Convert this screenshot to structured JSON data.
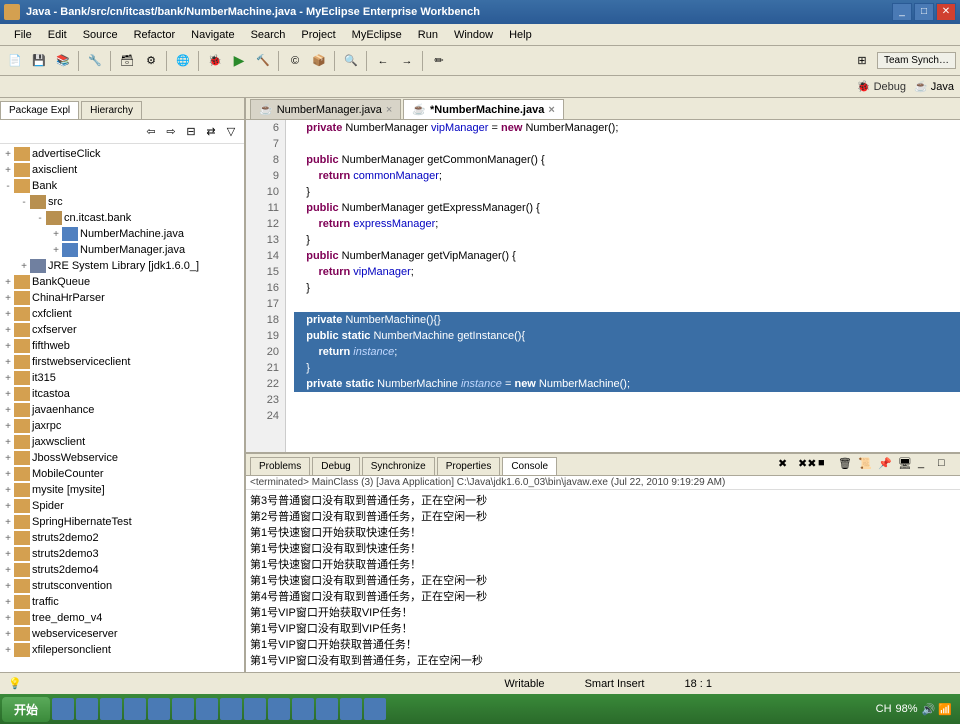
{
  "window": {
    "title": "Java - Bank/src/cn/itcast/bank/NumberMachine.java - MyEclipse Enterprise Workbench"
  },
  "menu": [
    "File",
    "Edit",
    "Source",
    "Refactor",
    "Navigate",
    "Search",
    "Project",
    "MyEclipse",
    "Run",
    "Window",
    "Help"
  ],
  "perspectives": {
    "teamSync": "Team Synch…",
    "debug": "Debug",
    "java": "Java"
  },
  "leftTabs": {
    "pkg": "Package Expl",
    "hier": "Hierarchy"
  },
  "tree": {
    "items": [
      {
        "l": 0,
        "t": "+",
        "i": "folder",
        "n": "advertiseClick"
      },
      {
        "l": 0,
        "t": "+",
        "i": "folder",
        "n": "axisclient"
      },
      {
        "l": 0,
        "t": "-",
        "i": "folder",
        "n": "Bank"
      },
      {
        "l": 1,
        "t": "-",
        "i": "pkg",
        "n": "src"
      },
      {
        "l": 2,
        "t": "-",
        "i": "pkg",
        "n": "cn.itcast.bank"
      },
      {
        "l": 3,
        "t": "+",
        "i": "jfile",
        "n": "NumberMachine.java"
      },
      {
        "l": 3,
        "t": "+",
        "i": "jfile",
        "n": "NumberManager.java"
      },
      {
        "l": 1,
        "t": "+",
        "i": "lib",
        "n": "JRE System Library [jdk1.6.0_]"
      },
      {
        "l": 0,
        "t": "+",
        "i": "folder",
        "n": "BankQueue"
      },
      {
        "l": 0,
        "t": "+",
        "i": "folder",
        "n": "ChinaHrParser"
      },
      {
        "l": 0,
        "t": "+",
        "i": "folder",
        "n": "cxfclient"
      },
      {
        "l": 0,
        "t": "+",
        "i": "folder",
        "n": "cxfserver"
      },
      {
        "l": 0,
        "t": "+",
        "i": "folder",
        "n": "fifthweb"
      },
      {
        "l": 0,
        "t": "+",
        "i": "folder",
        "n": "firstwebserviceclient"
      },
      {
        "l": 0,
        "t": "+",
        "i": "folder",
        "n": "it315"
      },
      {
        "l": 0,
        "t": "+",
        "i": "folder",
        "n": "itcastoa"
      },
      {
        "l": 0,
        "t": "+",
        "i": "folder",
        "n": "javaenhance"
      },
      {
        "l": 0,
        "t": "+",
        "i": "folder",
        "n": "jaxrpc"
      },
      {
        "l": 0,
        "t": "+",
        "i": "folder",
        "n": "jaxwsclient"
      },
      {
        "l": 0,
        "t": "+",
        "i": "folder",
        "n": "JbossWebservice"
      },
      {
        "l": 0,
        "t": "+",
        "i": "folder",
        "n": "MobileCounter"
      },
      {
        "l": 0,
        "t": "+",
        "i": "folder",
        "n": "mysite [mysite]"
      },
      {
        "l": 0,
        "t": "+",
        "i": "folder",
        "n": "Spider"
      },
      {
        "l": 0,
        "t": "+",
        "i": "folder",
        "n": "SpringHibernateTest"
      },
      {
        "l": 0,
        "t": "+",
        "i": "folder",
        "n": "struts2demo2"
      },
      {
        "l": 0,
        "t": "+",
        "i": "folder",
        "n": "struts2demo3"
      },
      {
        "l": 0,
        "t": "+",
        "i": "folder",
        "n": "struts2demo4"
      },
      {
        "l": 0,
        "t": "+",
        "i": "folder",
        "n": "strutsconvention"
      },
      {
        "l": 0,
        "t": "+",
        "i": "folder",
        "n": "traffic"
      },
      {
        "l": 0,
        "t": "+",
        "i": "folder",
        "n": "tree_demo_v4"
      },
      {
        "l": 0,
        "t": "+",
        "i": "folder",
        "n": "webserviceserver"
      },
      {
        "l": 0,
        "t": "+",
        "i": "folder",
        "n": "xfilepersonclient"
      }
    ]
  },
  "editorTabs": [
    {
      "name": "NumberManager.java",
      "active": false
    },
    {
      "name": "*NumberMachine.java",
      "active": true
    }
  ],
  "code": {
    "startLine": 6,
    "lines": [
      {
        "n": 6,
        "sel": false,
        "html": "    <span class='kw'>private</span> NumberManager <span class='fld'>vipManager</span> = <span class='kw'>new</span> NumberManager();"
      },
      {
        "n": 7,
        "sel": false,
        "html": ""
      },
      {
        "n": 8,
        "sel": false,
        "html": "    <span class='kw'>public</span> NumberManager getCommonManager() {"
      },
      {
        "n": 9,
        "sel": false,
        "html": "        <span class='kw'>return</span> <span class='fld'>commonManager</span>;"
      },
      {
        "n": 10,
        "sel": false,
        "html": "    }"
      },
      {
        "n": 11,
        "sel": false,
        "html": "    <span class='kw'>public</span> NumberManager getExpressManager() {"
      },
      {
        "n": 12,
        "sel": false,
        "html": "        <span class='kw'>return</span> <span class='fld'>expressManager</span>;"
      },
      {
        "n": 13,
        "sel": false,
        "html": "    }"
      },
      {
        "n": 14,
        "sel": false,
        "html": "    <span class='kw'>public</span> NumberManager getVipManager() {"
      },
      {
        "n": 15,
        "sel": false,
        "html": "        <span class='kw'>return</span> <span class='fld'>vipManager</span>;"
      },
      {
        "n": 16,
        "sel": false,
        "html": "    }"
      },
      {
        "n": 17,
        "sel": false,
        "html": ""
      },
      {
        "n": 18,
        "sel": true,
        "html": "    <span class='kw'>private</span> NumberMachine(){}"
      },
      {
        "n": 19,
        "sel": true,
        "html": "    <span class='kw'>public static</span> NumberMachine getInstance(){"
      },
      {
        "n": 20,
        "sel": true,
        "html": "        <span class='kw'>return</span> <span class='fld'>instance</span>;"
      },
      {
        "n": 21,
        "sel": true,
        "html": "    }"
      },
      {
        "n": 22,
        "sel": true,
        "html": "    <span class='kw'>private static</span> NumberMachine <span class='fld'>instance</span> = <span class='kw'>new</span> NumberMachine();"
      },
      {
        "n": 23,
        "sel": false,
        "html": ""
      },
      {
        "n": 24,
        "sel": false,
        "html": ""
      }
    ]
  },
  "bottomTabs": [
    "Problems",
    "Debug",
    "Synchronize",
    "Properties",
    "Console"
  ],
  "bottomActive": 4,
  "consoleHeader": "<terminated> MainClass (3) [Java Application] C:\\Java\\jdk1.6.0_03\\bin\\javaw.exe (Jul 22, 2010 9:19:29 AM)",
  "consoleLines": [
    "第3号普通窗口没有取到普通任务，正在空闲一秒",
    "第2号普通窗口没有取到普通任务，正在空闲一秒",
    "第1号快速窗口开始获取快速任务！",
    "第1号快速窗口没有取到快速任务！",
    "第1号快速窗口开始获取普通任务！",
    "第1号快速窗口没有取到普通任务，正在空闲一秒",
    "第4号普通窗口没有取到普通任务，正在空闲一秒",
    "第1号VIP窗口开始获取VIP任务！",
    "第1号VIP窗口没有取到VIP任务！",
    "第1号VIP窗口开始获取普通任务！",
    "第1号VIP窗口没有取到普通任务，正在空闲一秒"
  ],
  "status": {
    "writable": "Writable",
    "insert": "Smart Insert",
    "pos": "18 : 1"
  },
  "taskbar": {
    "start": "开始",
    "time": "",
    "cpu": "98%"
  }
}
